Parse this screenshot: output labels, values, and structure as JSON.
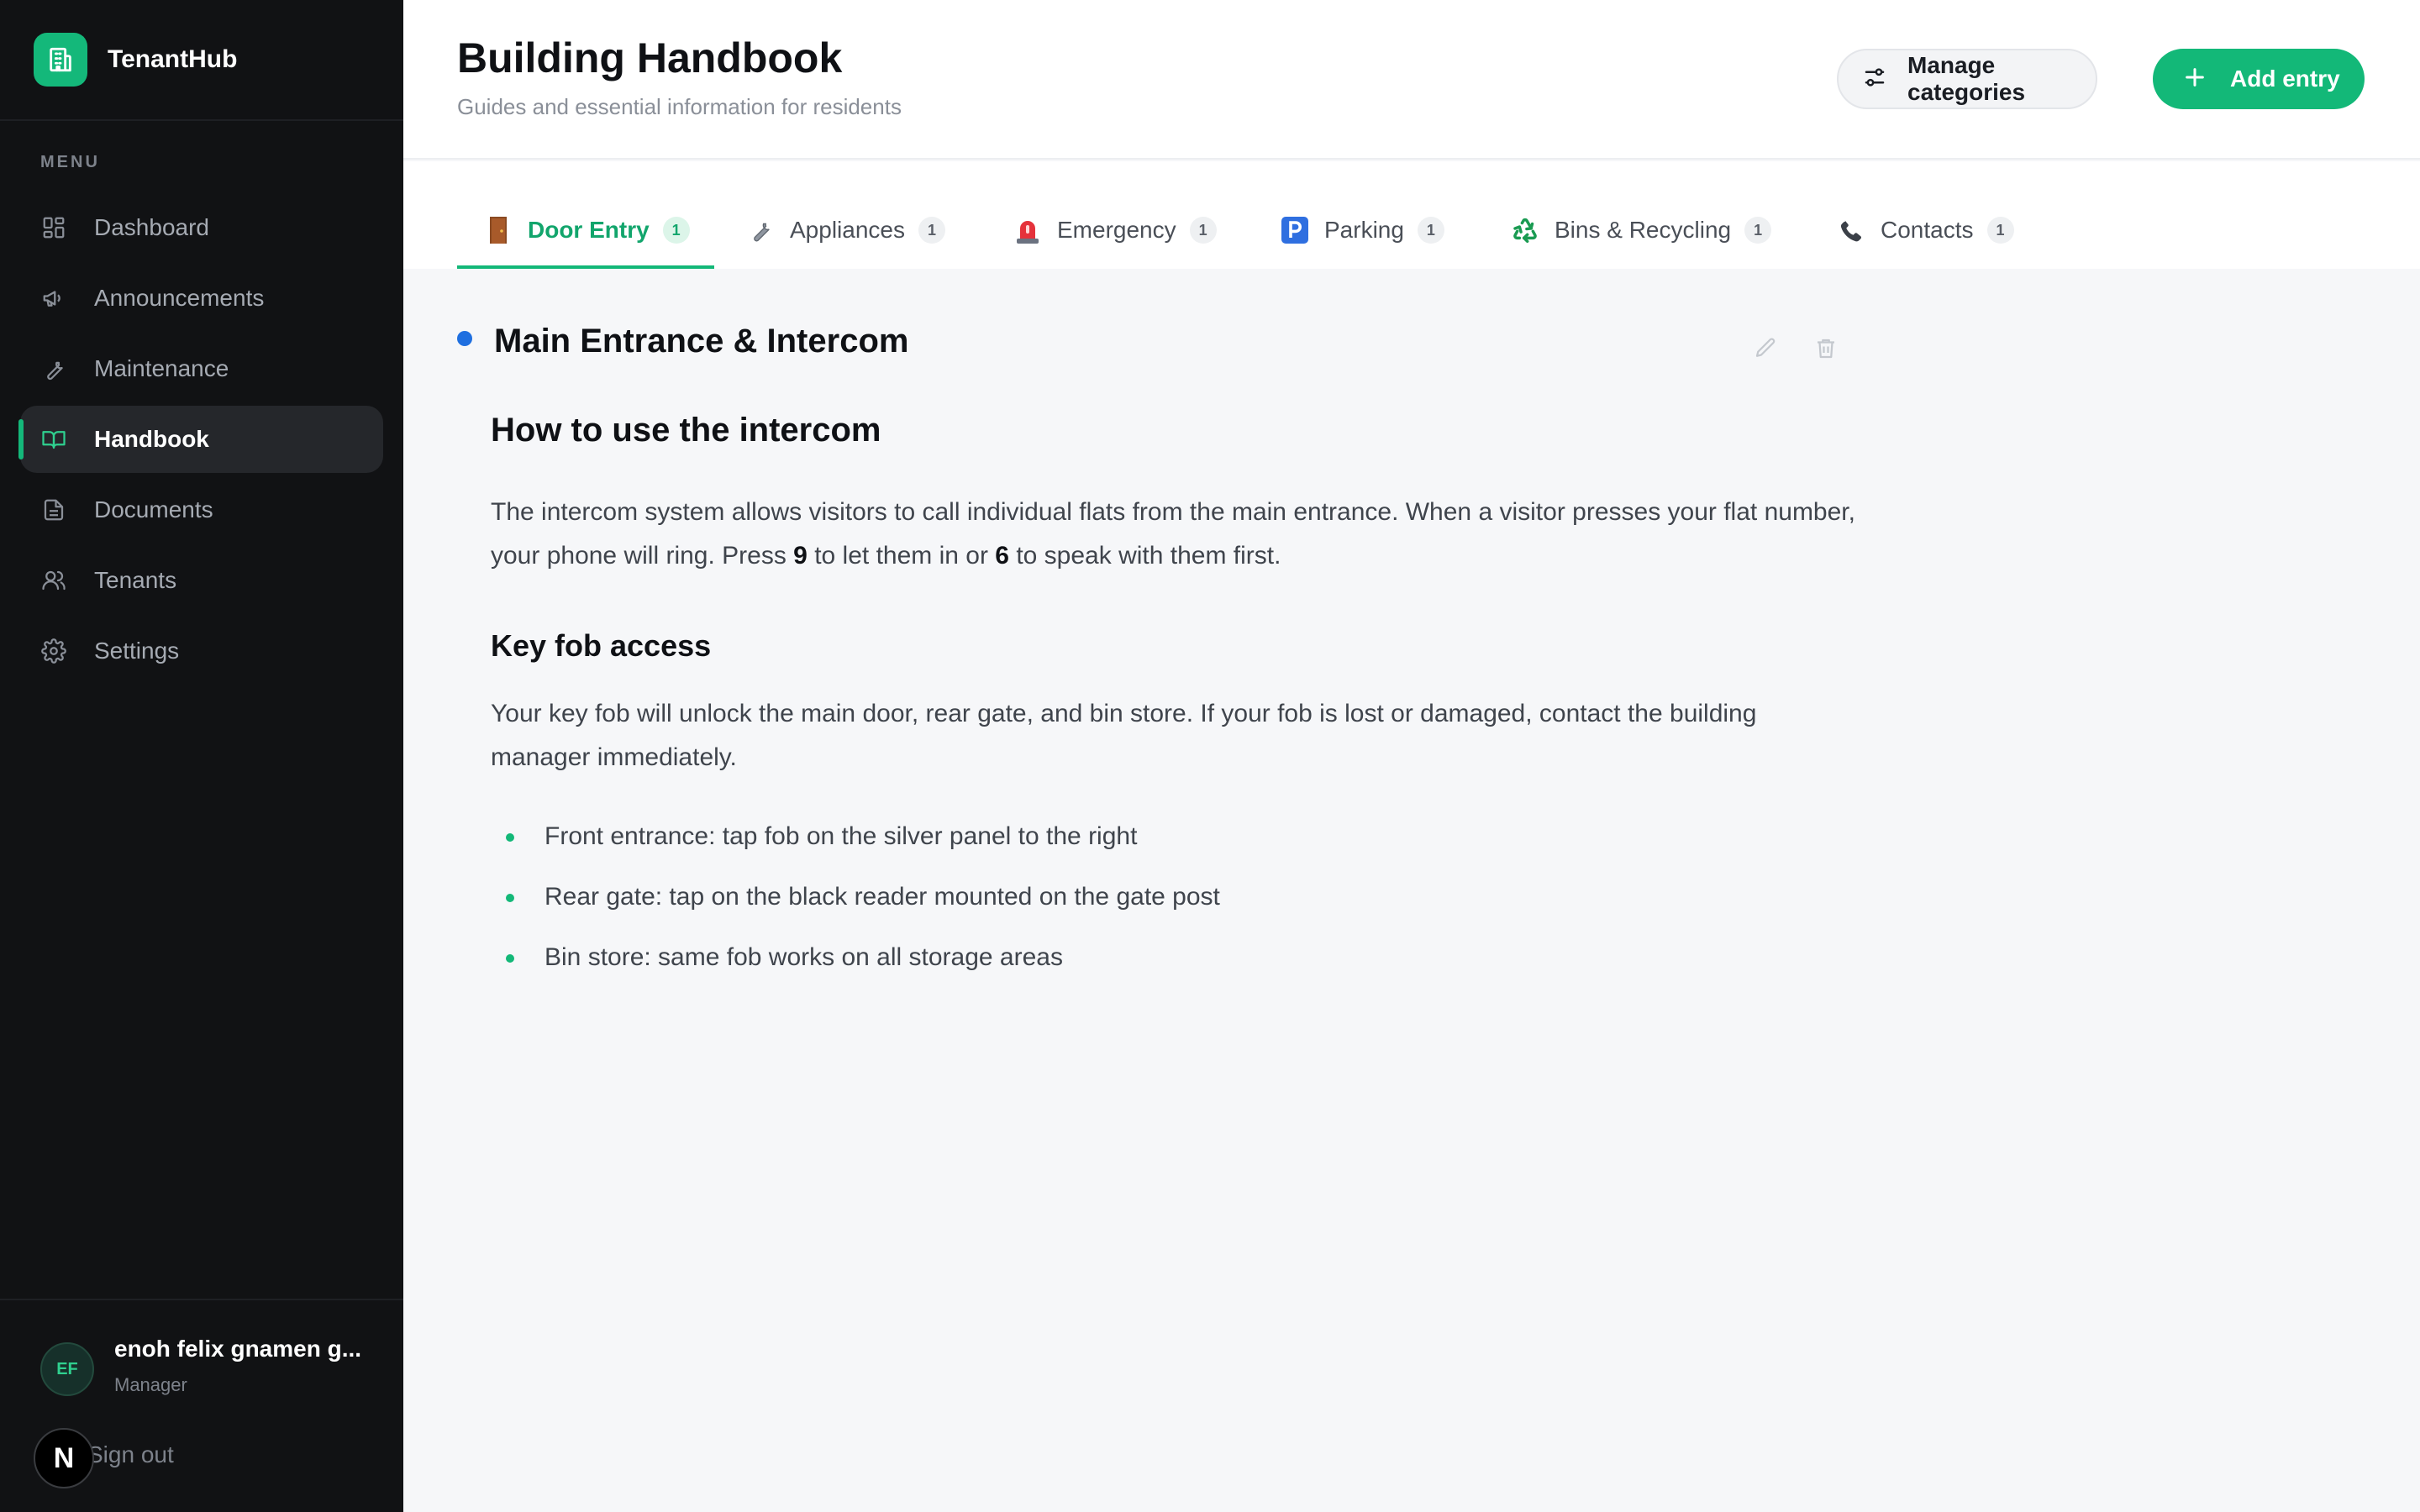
{
  "app": {
    "name": "TenantHub"
  },
  "sidebar": {
    "menu_label": "MENU",
    "items": [
      {
        "label": "Dashboard",
        "icon": "grid-icon"
      },
      {
        "label": "Announcements",
        "icon": "megaphone-icon"
      },
      {
        "label": "Maintenance",
        "icon": "wrench-icon"
      },
      {
        "label": "Handbook",
        "icon": "book-icon",
        "active": true
      },
      {
        "label": "Documents",
        "icon": "document-icon"
      },
      {
        "label": "Tenants",
        "icon": "users-icon"
      },
      {
        "label": "Settings",
        "icon": "gear-icon"
      }
    ]
  },
  "user": {
    "initials": "EF",
    "name": "enoh felix gnamen g...",
    "role": "Manager",
    "sign_out": "Sign out",
    "next_badge": "N"
  },
  "header": {
    "title": "Building Handbook",
    "subtitle": "Guides and essential information for residents",
    "manage_label": "Manage categories",
    "add_label": "Add entry"
  },
  "tabs": [
    {
      "label": "Door Entry",
      "count": "1",
      "icon": "door-icon",
      "active": true
    },
    {
      "label": "Appliances",
      "count": "1",
      "icon": "wrench-icon"
    },
    {
      "label": "Emergency",
      "count": "1",
      "icon": "siren-icon"
    },
    {
      "label": "Parking",
      "count": "1",
      "icon": "parking-icon"
    },
    {
      "label": "Bins & Recycling",
      "count": "1",
      "icon": "recycling-icon"
    },
    {
      "label": "Contacts",
      "count": "1",
      "icon": "phone-icon"
    }
  ],
  "entry": {
    "title": "Main Entrance & Intercom",
    "heading": "How to use the intercom",
    "para1_a": "The intercom system allows visitors to call individual flats from the main entrance. When a visitor presses your flat number, your phone will ring. Press ",
    "para1_b": "9",
    "para1_c": " to let them in or ",
    "para1_d": "6",
    "para1_e": " to speak with them first.",
    "subheading": "Key fob access",
    "para2": "Your key fob will unlock the main door, rear gate, and bin store. If your fob is lost or damaged, contact the building manager immediately.",
    "bullets": [
      "Front entrance: tap fob on the silver panel to the right",
      "Rear gate: tap on the black reader mounted on the gate post",
      "Bin store: same fob works on all storage areas"
    ]
  },
  "colors": {
    "accent": "#13b878",
    "sidebar_bg": "#111214",
    "entry_dot": "#1f6fe0"
  }
}
